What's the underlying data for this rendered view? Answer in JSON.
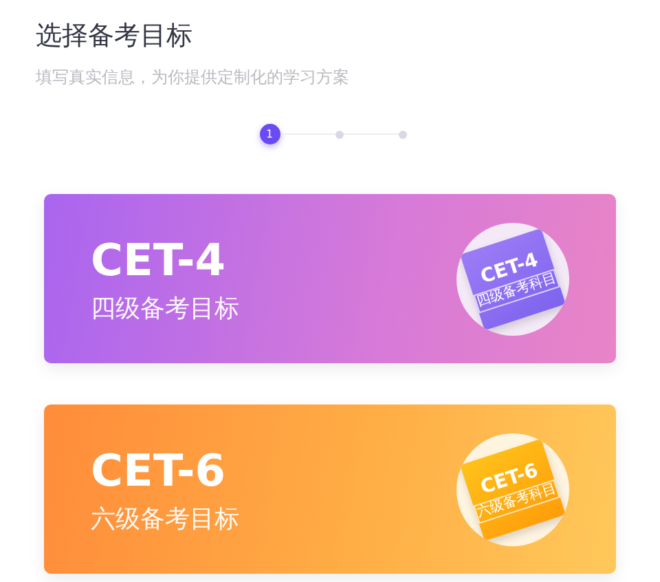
{
  "header": {
    "title": "选择备考目标",
    "subtitle": "填写真实信息，为你提供定制化的学习方案"
  },
  "steps": [
    {
      "label": "1",
      "selected": true
    },
    {
      "selected": false
    },
    {
      "selected": false
    }
  ],
  "cards": [
    {
      "kind": "purple",
      "title": "CET-4",
      "subtitle": "四级备考目标",
      "book_title": "CET-4",
      "book_subtitle": "四级备考科目"
    },
    {
      "kind": "orange",
      "title": "CET-6",
      "subtitle": "六级备考目标",
      "book_title": "CET-6",
      "book_subtitle": "六级备考科目"
    }
  ]
}
